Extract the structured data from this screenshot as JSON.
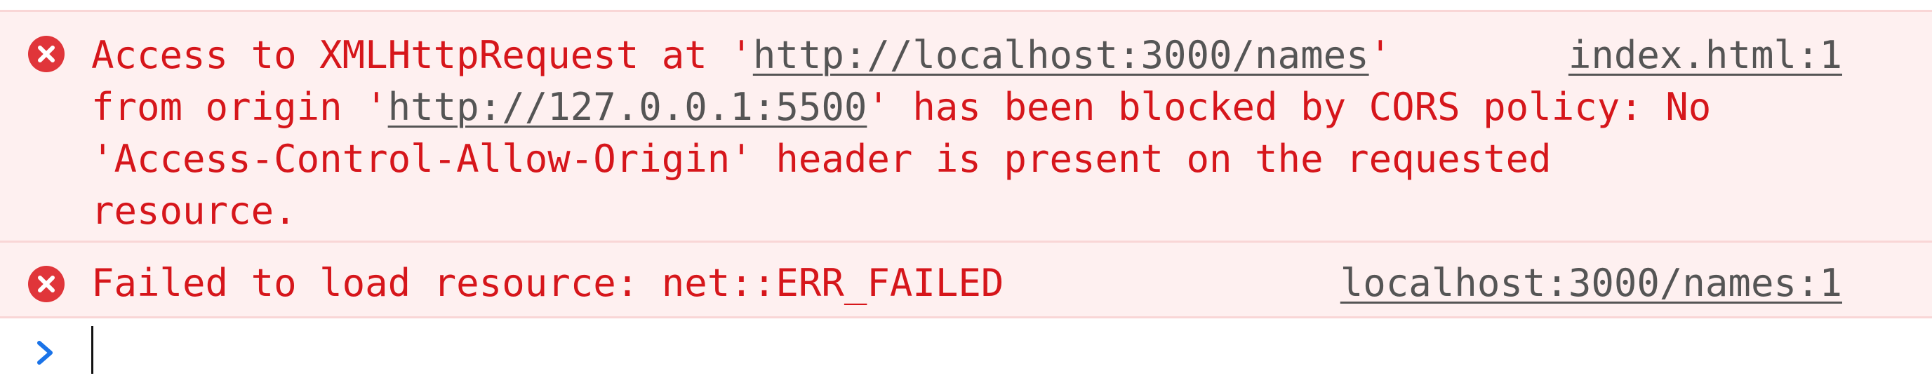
{
  "messages": [
    {
      "level": "error",
      "icon": "error-icon",
      "text_parts": {
        "p1": "Access to XMLHttpRequest at '",
        "url1": "http://localhost:3000/names",
        "p2": "'",
        "p3": "from origin '",
        "url2": "http://127.0.0.1:5500",
        "p4": "' has been blocked by CORS policy: No",
        "p5": "'Access-Control-Allow-Origin' header is present on the requested",
        "p6": "resource."
      },
      "source": "index.html:1"
    },
    {
      "level": "error",
      "icon": "error-icon",
      "text": "Failed to load resource: net::ERR_FAILED",
      "source": "localhost:3000/names:1"
    }
  ],
  "prompt": {
    "icon": "chevron-right-icon",
    "value": ""
  },
  "colors": {
    "error_text": "#d6161b",
    "error_bg": "#fef0f0",
    "error_border": "#f9d6d6",
    "error_icon": "#e0353a",
    "link": "#555555",
    "prompt_chevron": "#1a73e8"
  }
}
